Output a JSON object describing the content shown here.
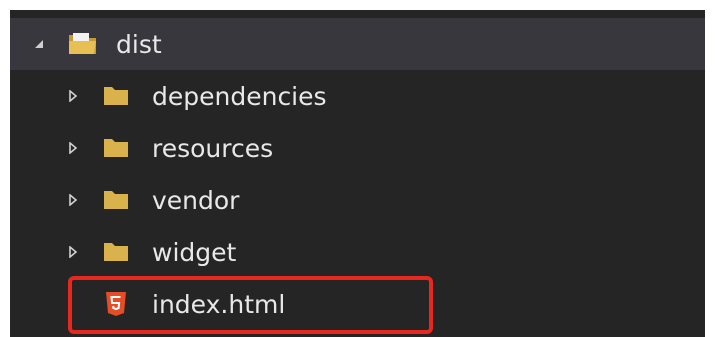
{
  "explorer": {
    "root": {
      "label": "dist",
      "expanded": true,
      "icon": "folder-open-icon"
    },
    "children": [
      {
        "label": "dependencies",
        "type": "folder",
        "icon": "folder-icon"
      },
      {
        "label": "resources",
        "type": "folder",
        "icon": "folder-icon"
      },
      {
        "label": "vendor",
        "type": "folder",
        "icon": "folder-icon"
      },
      {
        "label": "widget",
        "type": "folder",
        "icon": "folder-icon"
      },
      {
        "label": "index.html",
        "type": "file",
        "icon": "html5-icon",
        "highlighted": true
      }
    ]
  },
  "colors": {
    "panel_background": "#252526",
    "selected_row": "#37373d",
    "text": "#e8e8e8",
    "folder": "#d9b24c",
    "html_icon": "#e44d26",
    "highlight": "#e8281e"
  }
}
